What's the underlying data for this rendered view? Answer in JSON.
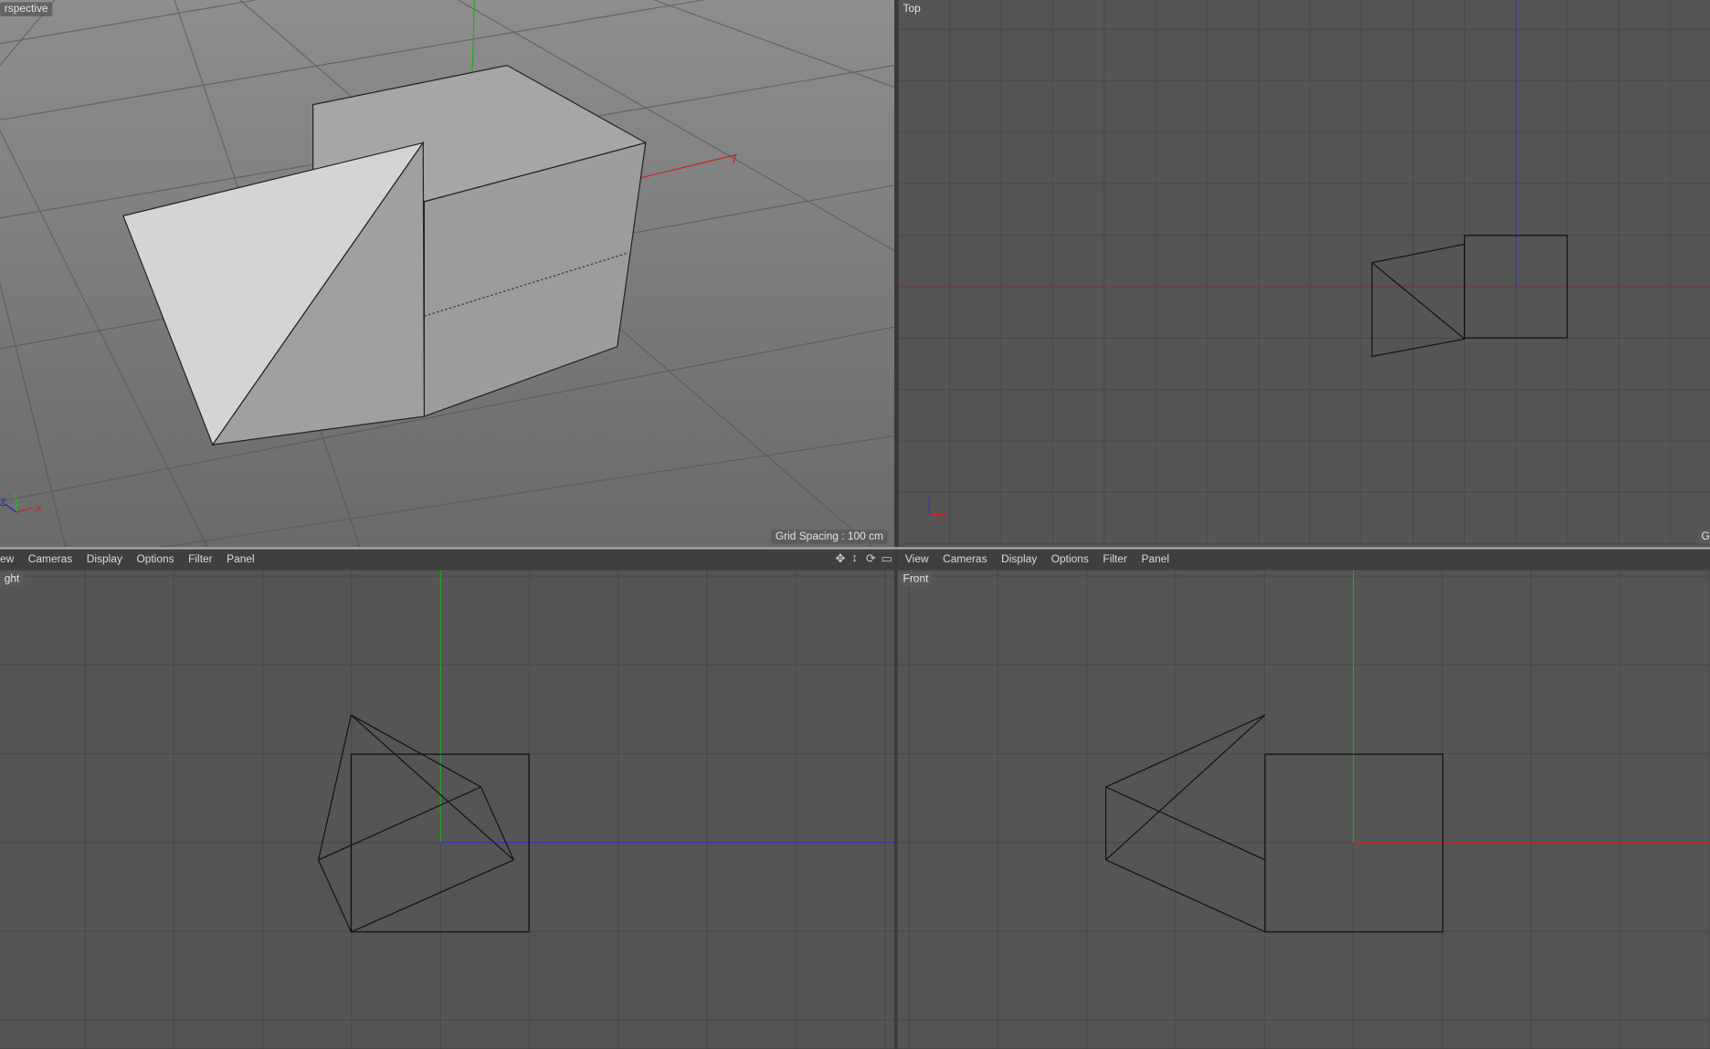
{
  "viewports": {
    "perspective": {
      "label": "rspective",
      "grid_spacing": "Grid Spacing : 100 cm"
    },
    "top": {
      "label": "Top",
      "grid_spacing": "G"
    },
    "right": {
      "label": "ght"
    },
    "front": {
      "label": "Front"
    }
  },
  "menus": {
    "left": [
      "ew",
      "Cameras",
      "Display",
      "Options",
      "Filter",
      "Panel"
    ],
    "right": [
      "View",
      "Cameras",
      "Display",
      "Options",
      "Filter",
      "Panel"
    ]
  },
  "toolbar_icons": [
    "move-icon",
    "zoom-icon",
    "rotate-icon",
    "maximize-icon"
  ],
  "axis_labels": {
    "x": "X",
    "y": "Y",
    "z": "Z"
  },
  "colors": {
    "x_axis": "#d02020",
    "y_axis": "#20b020",
    "z_axis": "#2020d0"
  }
}
